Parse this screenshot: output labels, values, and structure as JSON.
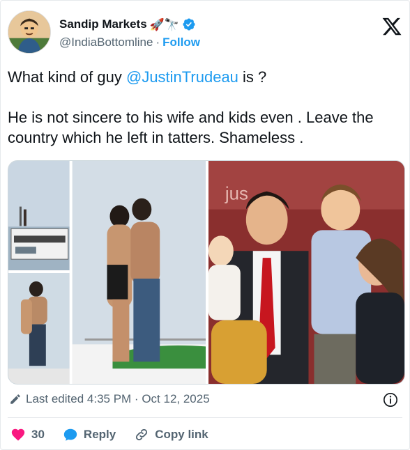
{
  "author": {
    "display_name": "Sandip Markets",
    "emoji": "🚀🔭",
    "handle": "@IndiaBottomline",
    "separator": "·",
    "follow_label": "Follow",
    "avatar_icon": "avatar-cartoon"
  },
  "platform_icon": "x-logo",
  "tweet": {
    "line1_prefix": "What kind of guy ",
    "mention": "@JustinTrudeau",
    "line1_suffix": " is ?",
    "body": "He is not sincere to his wife and kids even . Leave the country which he left in tatters. Shameless ."
  },
  "media": {
    "panels": [
      "yacht-photo",
      "embrace-closeup-photo",
      "embrace-large-photo",
      "family-photo"
    ],
    "sign_text": "jus"
  },
  "meta": {
    "edited_text": "Last edited 4:35 PM · Oct 12, 2025"
  },
  "actions": {
    "like_count": "30",
    "reply_label": "Reply",
    "copy_label": "Copy link"
  },
  "colors": {
    "accent": "#1d9bf0",
    "like": "#f91880",
    "text": "#0f1419",
    "muted": "#536471"
  }
}
